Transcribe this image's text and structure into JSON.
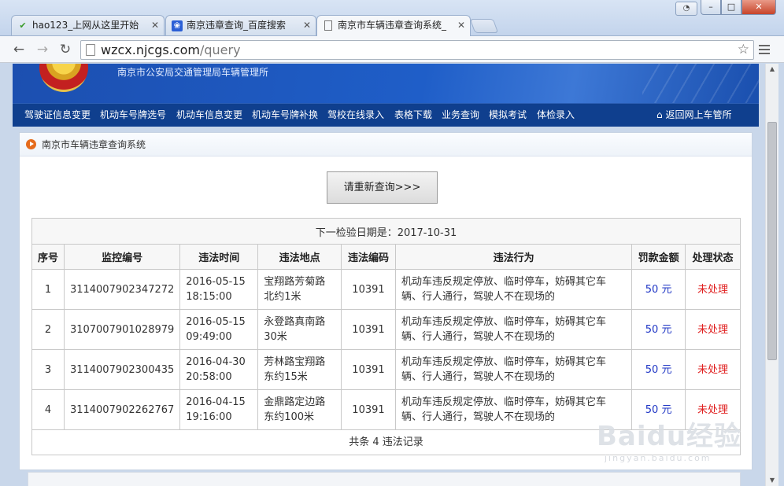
{
  "browser": {
    "tabs": [
      {
        "title": "hao123_上网从这里开始",
        "favicon": "hao123-icon"
      },
      {
        "title": "南京违章查询_百度搜索",
        "favicon": "baidu-paw-icon"
      },
      {
        "title": "南京市车辆违章查询系统_",
        "favicon": "page-icon",
        "active": true
      }
    ],
    "address": {
      "host": "wzcx.njcgs.com",
      "path": "/query"
    },
    "window_controls": {
      "minimize": "–",
      "maximize": "□",
      "close": "✕"
    }
  },
  "site": {
    "agency": "南京市公安局交通管理局车辆管理所",
    "nav": [
      "驾驶证信息变更",
      "机动车号牌选号",
      "机动车信息变更",
      "机动车号牌补换",
      "驾校在线录入",
      "表格下载",
      "业务查询",
      "模拟考试",
      "体检录入"
    ],
    "return_link": "返回网上车管所"
  },
  "panel": {
    "title": "南京市车辆违章查询系统",
    "requery_button": "请重新查询>>>",
    "next_inspection": "下一检验日期是：2017-10-31",
    "columns": [
      "序号",
      "监控编号",
      "违法时间",
      "违法地点",
      "违法编码",
      "违法行为",
      "罚款金额",
      "处理状态"
    ],
    "rows": [
      {
        "no": "1",
        "monitor_id": "3114007902347272",
        "date": "2016-05-15",
        "time": "18:15:00",
        "location": "宝翔路芳菊路北约1米",
        "code": "10391",
        "behavior": "机动车违反规定停放、临时停车，妨碍其它车辆、行人通行，驾驶人不在现场的",
        "fine": "50 元",
        "status": "未处理"
      },
      {
        "no": "2",
        "monitor_id": "3107007901028979",
        "date": "2016-05-15",
        "time": "09:49:00",
        "location": "永登路真南路30米",
        "code": "10391",
        "behavior": "机动车违反规定停放、临时停车，妨碍其它车辆、行人通行，驾驶人不在现场的",
        "fine": "50 元",
        "status": "未处理"
      },
      {
        "no": "3",
        "monitor_id": "3114007902300435",
        "date": "2016-04-30",
        "time": "20:58:00",
        "location": "芳林路宝翔路东约15米",
        "code": "10391",
        "behavior": "机动车违反规定停放、临时停车，妨碍其它车辆、行人通行，驾驶人不在现场的",
        "fine": "50 元",
        "status": "未处理"
      },
      {
        "no": "4",
        "monitor_id": "3114007902262767",
        "date": "2016-04-15",
        "time": "19:16:00",
        "location": "金鼎路定边路东约100米",
        "code": "10391",
        "behavior": "机动车违反规定停放、临时停车，妨碍其它车辆、行人通行，驾驶人不在现场的",
        "fine": "50 元",
        "status": "未处理"
      }
    ],
    "total": "共条 4 违法记录"
  },
  "watermark": {
    "logo": "Baidu经验",
    "site": "jingyan.baidu.com"
  },
  "colors": {
    "nav_bg": "#0f3f8e",
    "banner": "#1f5ec8",
    "fine": "#1f36c5",
    "status": "#e02020",
    "icon_orange": "#e56b1c"
  }
}
